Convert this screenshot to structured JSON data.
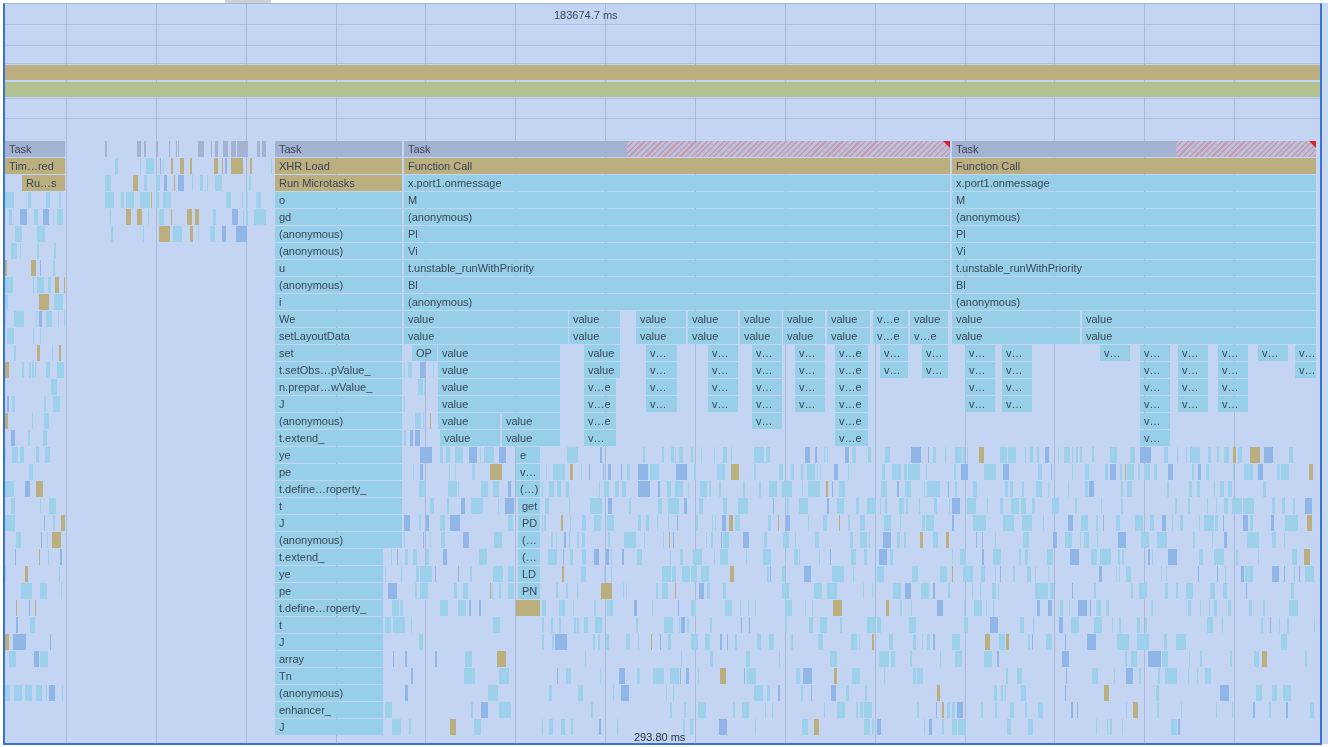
{
  "ruler": {
    "top_time": "183674.7 ms",
    "bottom_time": "293.80 ms"
  },
  "tracks": [
    {
      "kind": "script"
    },
    {
      "kind": "frames"
    }
  ],
  "flame_chart": {
    "columns": [
      {
        "events": [
          {
            "label": "Task",
            "kind": "task",
            "long_task": false
          },
          {
            "label": "Tim…red",
            "kind": "script"
          },
          {
            "label": "Ru…s",
            "kind": "script"
          }
        ]
      },
      {
        "events": [
          {
            "label": "Task",
            "kind": "task",
            "long_task": false
          },
          {
            "label": "XHR Load",
            "kind": "script"
          },
          {
            "label": "Run Microtasks",
            "kind": "script"
          },
          {
            "label": "o",
            "kind": "js"
          },
          {
            "label": "gd",
            "kind": "js"
          },
          {
            "label": "(anonymous)",
            "kind": "js"
          },
          {
            "label": "(anonymous)",
            "kind": "js"
          },
          {
            "label": "u",
            "kind": "js"
          },
          {
            "label": "(anonymous)",
            "kind": "js"
          },
          {
            "label": "i",
            "kind": "js"
          },
          {
            "label": "We",
            "kind": "js"
          },
          {
            "label": "setLayoutData",
            "kind": "js"
          },
          {
            "label": "set",
            "kind": "js"
          },
          {
            "label": "t.setObs…pValue_",
            "kind": "js"
          },
          {
            "label": "n.prepar…wValue_",
            "kind": "js"
          },
          {
            "label": "J",
            "kind": "js"
          },
          {
            "label": "(anonymous)",
            "kind": "js"
          },
          {
            "label": "t.extend_",
            "kind": "js"
          },
          {
            "label": "ye",
            "kind": "js"
          },
          {
            "label": "pe",
            "kind": "js"
          },
          {
            "label": "t.define…roperty_",
            "kind": "js"
          },
          {
            "label": "t",
            "kind": "js"
          },
          {
            "label": "J",
            "kind": "js"
          },
          {
            "label": "(anonymous)",
            "kind": "js"
          },
          {
            "label": "t.extend_",
            "kind": "js"
          },
          {
            "label": "ye",
            "kind": "js"
          },
          {
            "label": "pe",
            "kind": "js"
          },
          {
            "label": "t.define…roperty_",
            "kind": "js"
          },
          {
            "label": "t",
            "kind": "js"
          },
          {
            "label": "J",
            "kind": "js"
          },
          {
            "label": "array",
            "kind": "js"
          },
          {
            "label": "Tn",
            "kind": "js"
          },
          {
            "label": "(anonymous)",
            "kind": "js"
          },
          {
            "label": "enhancer_",
            "kind": "js"
          },
          {
            "label": "J",
            "kind": "js"
          }
        ]
      },
      {
        "events": [
          {
            "label": "Task",
            "kind": "task",
            "long_task": true
          },
          {
            "label": "Function Call",
            "kind": "script"
          },
          {
            "label": "x.port1.onmessage",
            "kind": "js"
          },
          {
            "label": "M",
            "kind": "js"
          },
          {
            "label": "(anonymous)",
            "kind": "js"
          },
          {
            "label": "Pl",
            "kind": "js"
          },
          {
            "label": "Vi",
            "kind": "js"
          },
          {
            "label": "t.unstable_runWithPriority",
            "kind": "js"
          },
          {
            "label": "Bl",
            "kind": "js"
          },
          {
            "label": "(anonymous)",
            "kind": "js"
          },
          {
            "label": "value",
            "kind": "js"
          },
          {
            "label": "value",
            "kind": "js"
          },
          {
            "label": "value",
            "kind": "js"
          },
          {
            "label": "value",
            "kind": "js"
          },
          {
            "label": "value",
            "kind": "js"
          },
          {
            "label": "value",
            "kind": "js"
          },
          {
            "label": "value",
            "kind": "js"
          },
          {
            "label": "v…e",
            "kind": "js"
          },
          {
            "label": "value",
            "kind": "js"
          },
          {
            "label": "value",
            "kind": "js"
          },
          {
            "label": "value",
            "kind": "js"
          },
          {
            "label": "value",
            "kind": "js"
          },
          {
            "label": "value",
            "kind": "js"
          },
          {
            "label": "value",
            "kind": "js"
          },
          {
            "label": "value",
            "kind": "js"
          },
          {
            "label": "value",
            "kind": "js"
          },
          {
            "label": "v…e",
            "kind": "js"
          },
          {
            "label": "v…e",
            "kind": "js"
          },
          {
            "label": "OP",
            "kind": "js"
          },
          {
            "label": "value",
            "kind": "js"
          },
          {
            "label": "value",
            "kind": "js"
          },
          {
            "label": "v…",
            "kind": "js"
          },
          {
            "label": "v…",
            "kind": "js"
          },
          {
            "label": "v…",
            "kind": "js"
          },
          {
            "label": "v…",
            "kind": "js"
          },
          {
            "label": "v…e",
            "kind": "js"
          },
          {
            "label": "v…",
            "kind": "js"
          },
          {
            "label": "v…",
            "kind": "js"
          },
          {
            "label": "value",
            "kind": "js"
          },
          {
            "label": "value",
            "kind": "js"
          },
          {
            "label": "v…",
            "kind": "js"
          },
          {
            "label": "v…",
            "kind": "js"
          },
          {
            "label": "v…",
            "kind": "js"
          },
          {
            "label": "v…",
            "kind": "js"
          },
          {
            "label": "v…e",
            "kind": "js"
          },
          {
            "label": "v…",
            "kind": "js"
          },
          {
            "label": "v…",
            "kind": "js"
          },
          {
            "label": "value",
            "kind": "js"
          },
          {
            "label": "v…e",
            "kind": "js"
          },
          {
            "label": "v…",
            "kind": "js"
          },
          {
            "label": "v…",
            "kind": "js"
          },
          {
            "label": "v…",
            "kind": "js"
          },
          {
            "label": "v…",
            "kind": "js"
          },
          {
            "label": "v…e",
            "kind": "js"
          },
          {
            "label": "value",
            "kind": "js"
          },
          {
            "label": "v…e",
            "kind": "js"
          },
          {
            "label": "v…",
            "kind": "js"
          },
          {
            "label": "v…",
            "kind": "js"
          },
          {
            "label": "v…",
            "kind": "js"
          },
          {
            "label": "v…",
            "kind": "js"
          },
          {
            "label": "v…e",
            "kind": "js"
          },
          {
            "label": "value",
            "kind": "js"
          },
          {
            "label": "value",
            "kind": "js"
          },
          {
            "label": "v…e",
            "kind": "js"
          },
          {
            "label": "v…",
            "kind": "js"
          },
          {
            "label": "v…e",
            "kind": "js"
          },
          {
            "label": "value",
            "kind": "js"
          },
          {
            "label": "value",
            "kind": "js"
          },
          {
            "label": "v…",
            "kind": "js"
          },
          {
            "label": "v…e",
            "kind": "js"
          },
          {
            "label": "e",
            "kind": "js"
          },
          {
            "label": "v…",
            "kind": "js"
          },
          {
            "label": "(…)",
            "kind": "js"
          },
          {
            "label": "get",
            "kind": "js"
          },
          {
            "label": "PD",
            "kind": "js"
          },
          {
            "label": "(…",
            "kind": "js"
          },
          {
            "label": "(…",
            "kind": "js"
          },
          {
            "label": "LD",
            "kind": "js"
          },
          {
            "label": "PN",
            "kind": "js"
          },
          {
            "kind": "script"
          }
        ]
      },
      {
        "events": [
          {
            "label": "Task",
            "kind": "task",
            "long_task": true
          },
          {
            "label": "Function Call",
            "kind": "script"
          },
          {
            "label": "x.port1.onmessage",
            "kind": "js"
          },
          {
            "label": "M",
            "kind": "js"
          },
          {
            "label": "(anonymous)",
            "kind": "js"
          },
          {
            "label": "Pl",
            "kind": "js"
          },
          {
            "label": "Vi",
            "kind": "js"
          },
          {
            "label": "t.unstable_runWithPriority",
            "kind": "js"
          },
          {
            "label": "Bl",
            "kind": "js"
          },
          {
            "label": "(anonymous)",
            "kind": "js"
          },
          {
            "label": "value",
            "kind": "js"
          },
          {
            "label": "value",
            "kind": "js"
          },
          {
            "label": "value",
            "kind": "js"
          },
          {
            "label": "value",
            "kind": "js"
          },
          {
            "label": "v…",
            "kind": "js"
          },
          {
            "label": "v…",
            "kind": "js"
          },
          {
            "label": "v…",
            "kind": "js"
          },
          {
            "label": "v…",
            "kind": "js"
          },
          {
            "label": "v…",
            "kind": "js"
          },
          {
            "label": "v…",
            "kind": "js"
          },
          {
            "label": "v…",
            "kind": "js"
          },
          {
            "label": "v…",
            "kind": "js"
          },
          {
            "label": "v…",
            "kind": "js"
          },
          {
            "label": "v…",
            "kind": "js"
          },
          {
            "label": "v…",
            "kind": "js"
          },
          {
            "label": "v…",
            "kind": "js"
          },
          {
            "label": "v…",
            "kind": "js"
          },
          {
            "label": "v…",
            "kind": "js"
          },
          {
            "label": "v…",
            "kind": "js"
          },
          {
            "label": "v…",
            "kind": "js"
          },
          {
            "label": "v…",
            "kind": "js"
          },
          {
            "label": "v…",
            "kind": "js"
          },
          {
            "label": "v…",
            "kind": "js"
          },
          {
            "label": "v…",
            "kind": "js"
          },
          {
            "label": "v…",
            "kind": "js"
          },
          {
            "label": "v…",
            "kind": "js"
          },
          {
            "label": "v…",
            "kind": "js"
          },
          {
            "label": "v…",
            "kind": "js"
          },
          {
            "label": "v…",
            "kind": "js"
          },
          {
            "label": "v…",
            "kind": "js"
          }
        ]
      }
    ]
  }
}
